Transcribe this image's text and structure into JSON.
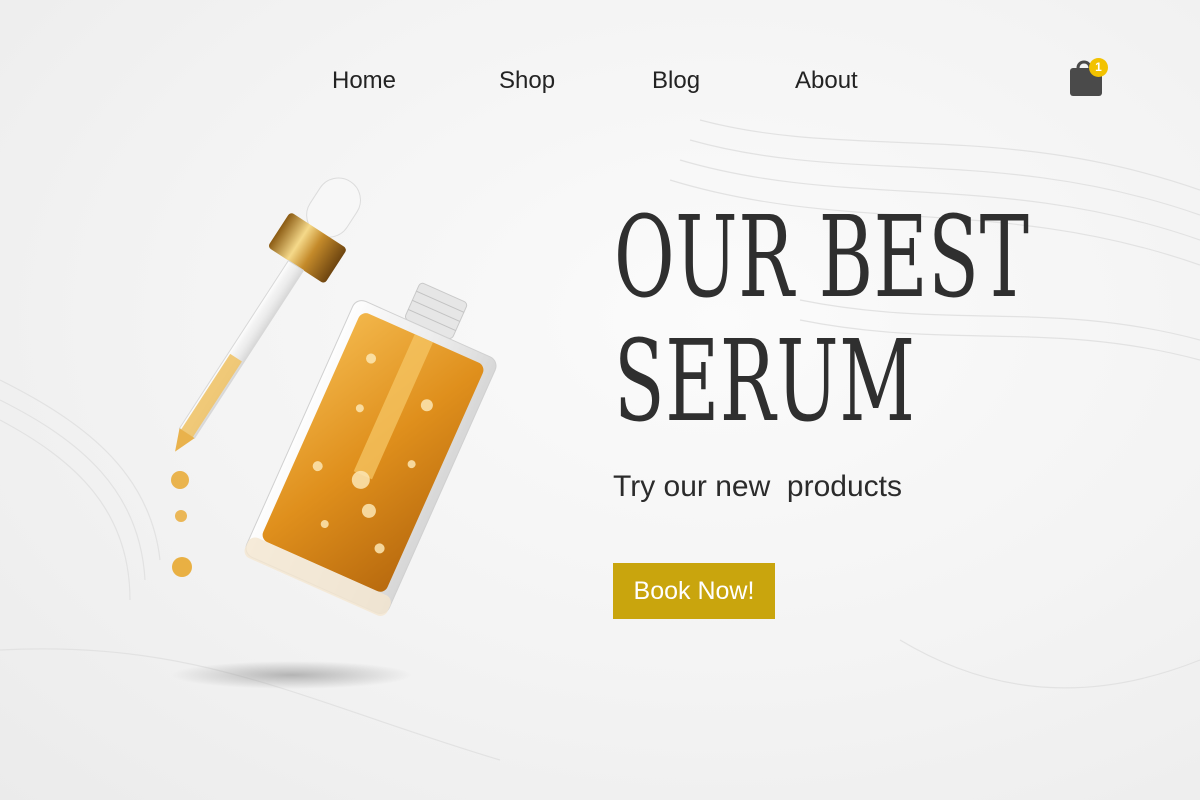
{
  "nav": {
    "items": [
      {
        "label": "Home"
      },
      {
        "label": "Shop"
      },
      {
        "label": "Blog"
      },
      {
        "label": "About"
      }
    ]
  },
  "cart": {
    "count": "1",
    "icon": "shopping-bag-icon"
  },
  "hero": {
    "title_line1": "OUR BEST",
    "title_line2": "SERUM",
    "subtitle": "Try our new  products",
    "cta_label": "Book Now!"
  },
  "colors": {
    "accent": "#c9a50d",
    "badge": "#f2c200",
    "text": "#2b2b2b",
    "serum": "#e7a22a"
  }
}
